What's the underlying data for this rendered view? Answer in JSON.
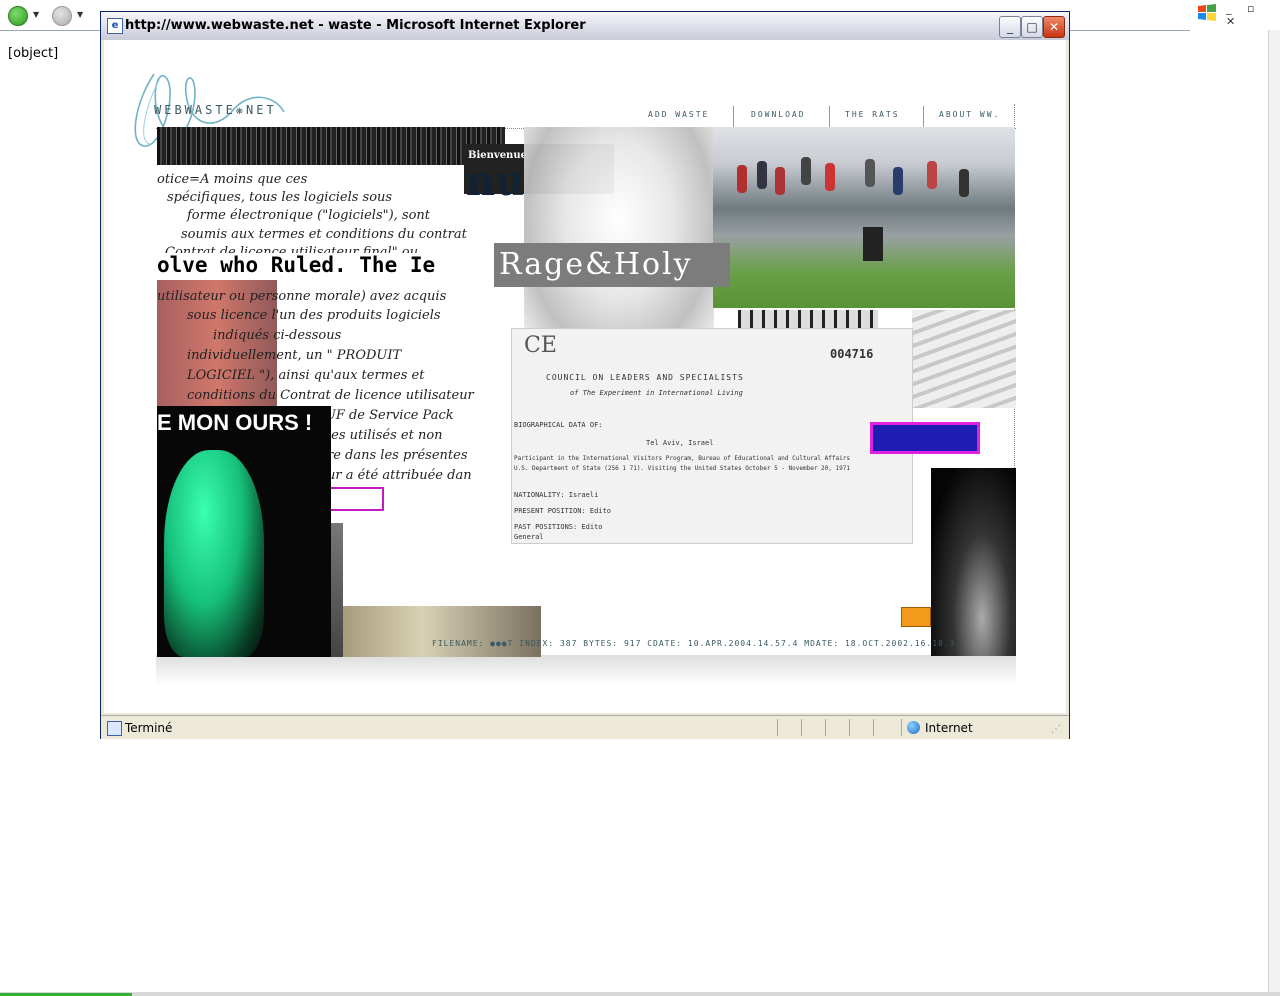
{
  "host": {
    "object_text": "[object]"
  },
  "window": {
    "title": "http://www.webwaste.net - waste - Microsoft Internet Explorer",
    "min_label": "_",
    "max_label": "□",
    "close_label": "✕"
  },
  "site": {
    "logo": "WEBWASTE❋NET",
    "nav": [
      "ADD WASTE",
      "DOWNLOAD",
      "THE RATS",
      "ABOUT WW."
    ],
    "footer": "FILENAME: ●●●T   INDEX: 387   BYTES: 917   CDATE: 10.APR.2004.14.57.4   MDATE: 18.OCT.2002.16.18.3"
  },
  "collage": {
    "bienvenue": "Bienvenue",
    "big_nu": "nu",
    "rage_holy": "Rage&Holy",
    "bold_strip": "olve who Ruled. The Ie",
    "mon_ours": "E MON OURS !",
    "french_lines": [
      "otice=A moins que ces",
      "spécifiques, tous les logiciels sous",
      "forme électronique (\"logiciels\"), sont",
      "soumis aux termes et conditions du contrat",
      "Contrat de licence utilisateur final\" ou",
      "utilisateur ou personne morale) avez acquis",
      "sous licence l'un des produits logiciels",
      "indiqués ci-dessous",
      "individuellement, un \" PRODUIT",
      "LOGICIEL \"), ainsi qu'aux termes et",
      "conditions du Contrat de licence utilisateur",
      "CLUF de Service Pack",
      "les utilisés et non",
      "re dans les présentes",
      "ur a été attribuée dan"
    ],
    "document_lines": [
      "COUNCIL ON LEADERS AND SPECIALISTS",
      "of The Experiment in International Living",
      "BIOGRAPHICAL DATA OF:",
      "Tel Aviv, Israel",
      "Participant in the International Visitors Program, Bureau of Educational and Cultural Affairs",
      "U.S. Department of State (256 1 71). Visiting the United States October 5 - November 20, 1971",
      "NATIONALITY:          Israeli",
      "PRESENT POSITION:     Edito",
      "PAST POSITIONS:       Edito",
      "                      General"
    ],
    "doc_number": "004716"
  },
  "status": {
    "text": "Terminé",
    "zone": "Internet"
  },
  "colors": {
    "ie_title_bg": "#dfe0ea",
    "close_button": "#c83413",
    "site_text": "#3b5a63"
  }
}
